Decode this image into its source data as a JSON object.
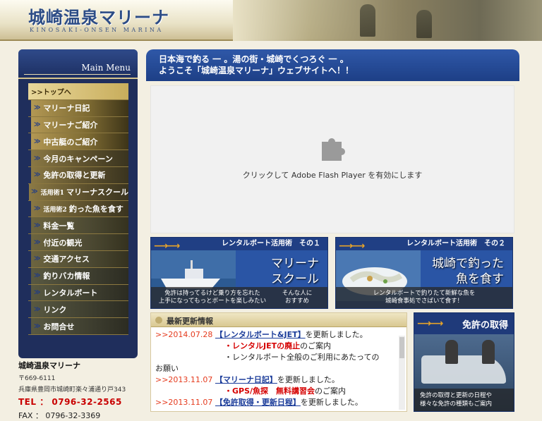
{
  "header": {
    "title": "城崎温泉マリーナ",
    "subtitle": "KINOSAKI-ONSEN MARINA"
  },
  "sidebar": {
    "heading": "Main Menu",
    "top_item": ">>トップへ",
    "items": [
      {
        "label": "マリーナ日記"
      },
      {
        "label": "マリーナご紹介"
      },
      {
        "label": "中古艇のご紹介"
      },
      {
        "label": "今月のキャンペーン"
      },
      {
        "label": "免許の取得と更新"
      },
      {
        "prefix": "活用術1",
        "label": "マリーナスクール"
      },
      {
        "prefix": "活用術2",
        "label": "釣った魚を食す"
      },
      {
        "label": "料金一覧"
      },
      {
        "label": "付近の観光"
      },
      {
        "label": "交通アクセス"
      },
      {
        "label": "釣りバカ情報"
      },
      {
        "label": "レンタルボート"
      },
      {
        "label": "リンク"
      },
      {
        "label": "お問合せ"
      }
    ]
  },
  "contact": {
    "name": "城崎温泉マリーナ",
    "zip": "〒669-6111",
    "address": "兵庫県豊岡市城崎町楽々浦通り戸343",
    "tel": "TEL ： 0796-32-2565",
    "fax": "FAX ： 0796-32-3369"
  },
  "banner": {
    "line1": "日本海で釣る 一 。湯の街・城崎でくつろぐ 一 。",
    "line2": "ようこそ「城崎温泉マリーナ」ウェブサイトへ！！"
  },
  "flash": {
    "message": "クリックして Adobe Flash Player を有効にします"
  },
  "promo1": {
    "title": "レンタルボート活用術　その１",
    "big1": "マリーナ",
    "big2": "スクール",
    "cap1": "免許は持ってるけど乗り方を忘れた",
    "cap2": "上手になってもっとボートを楽しみたい",
    "cap3": "そんな人に",
    "cap4": "おすすめ"
  },
  "promo2": {
    "title": "レンタルボート活用術　その２",
    "big1": "城崎で釣った",
    "big2": "魚を食す",
    "cap1": "レンタルボートで釣りたて新鮮な魚を",
    "cap2": "城崎食事処でさばいて食す！"
  },
  "news": {
    "heading": "最新更新情報",
    "entries": {
      "e1_date": ">>2014.07.28",
      "e1_link": "【レンタルボート&JET】",
      "e1_text": "を更新しました。",
      "e1_sub1_red": "・レンタルJETの廃止",
      "e1_sub1_text": "のご案内",
      "e1_sub2": "・レンタルボート全般のご利用にあたっての",
      "e1_sub2_cont": "お願い",
      "e2_date": ">>2013.11.07",
      "e2_link": "【マリーナ日記】",
      "e2_text": "を更新しました。",
      "e2_sub_red": "・GPS/魚探　無料講習会",
      "e2_sub_text": "のご案内",
      "e3_date": ">>2013.11.07",
      "e3_link": "【免許取得・更新日程】",
      "e3_text": "を更新しました。"
    }
  },
  "license": {
    "title": "免許の取得",
    "cap1": "免許の取得と更新の日程や",
    "cap2": "様々な免許の種類もご案内"
  },
  "colors": {
    "brand_blue": "#1d3f86",
    "accent_red": "#c80000",
    "gold": "#d6c58d"
  }
}
